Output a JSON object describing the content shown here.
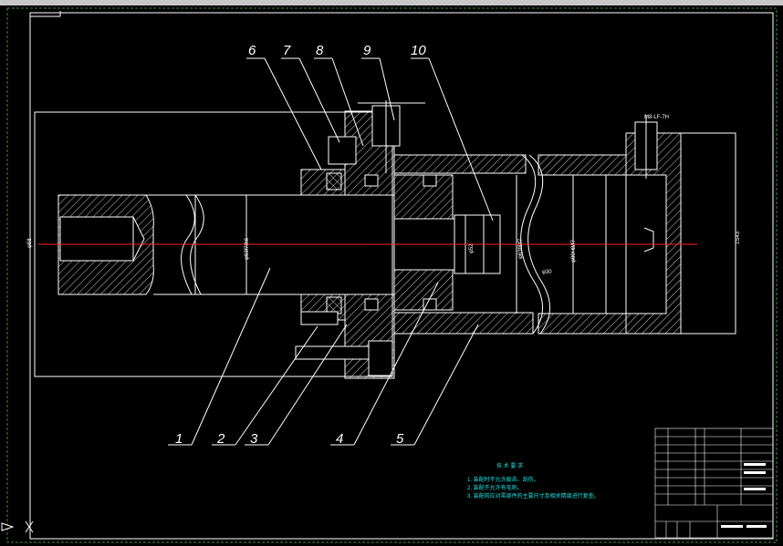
{
  "drawing": {
    "part_labels": [
      "1",
      "2",
      "3",
      "4",
      "5",
      "6",
      "7",
      "8",
      "9",
      "10"
    ],
    "thread_note": "M8-LF-7H",
    "tech_title": "技 术 要 求",
    "tech_notes": [
      "1. 装配时不允许敲击、刮伤。",
      "2. 装配不允许有毛刺。",
      "3. 装配前应对零部件的主要尺寸及相关精度进行复查。"
    ],
    "dims": [
      "φ68",
      "φ63f7/h6",
      "φ52",
      "φ63f8/f7",
      "φ80H8/f7",
      "φ30",
      "1S43"
    ],
    "colors": {
      "background": "#000000",
      "lines": "#ffffff",
      "centerline": "#ff2020",
      "notes": "#19e0e0",
      "frame_dash": "#2a7a2a"
    }
  }
}
